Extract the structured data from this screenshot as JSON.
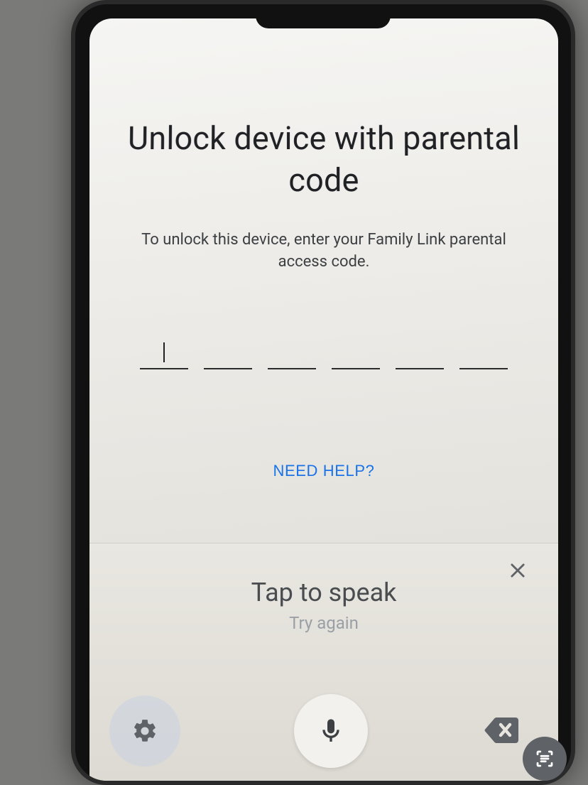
{
  "header": {
    "title": "Unlock device with parental code",
    "subtitle": "To unlock this device, enter your Family Link parental access code."
  },
  "code_input": {
    "length": 6,
    "values": [
      "",
      "",
      "",
      "",
      "",
      ""
    ]
  },
  "help_link": "NEED HELP?",
  "voice_panel": {
    "title": "Tap to speak",
    "subtitle": "Try again"
  }
}
